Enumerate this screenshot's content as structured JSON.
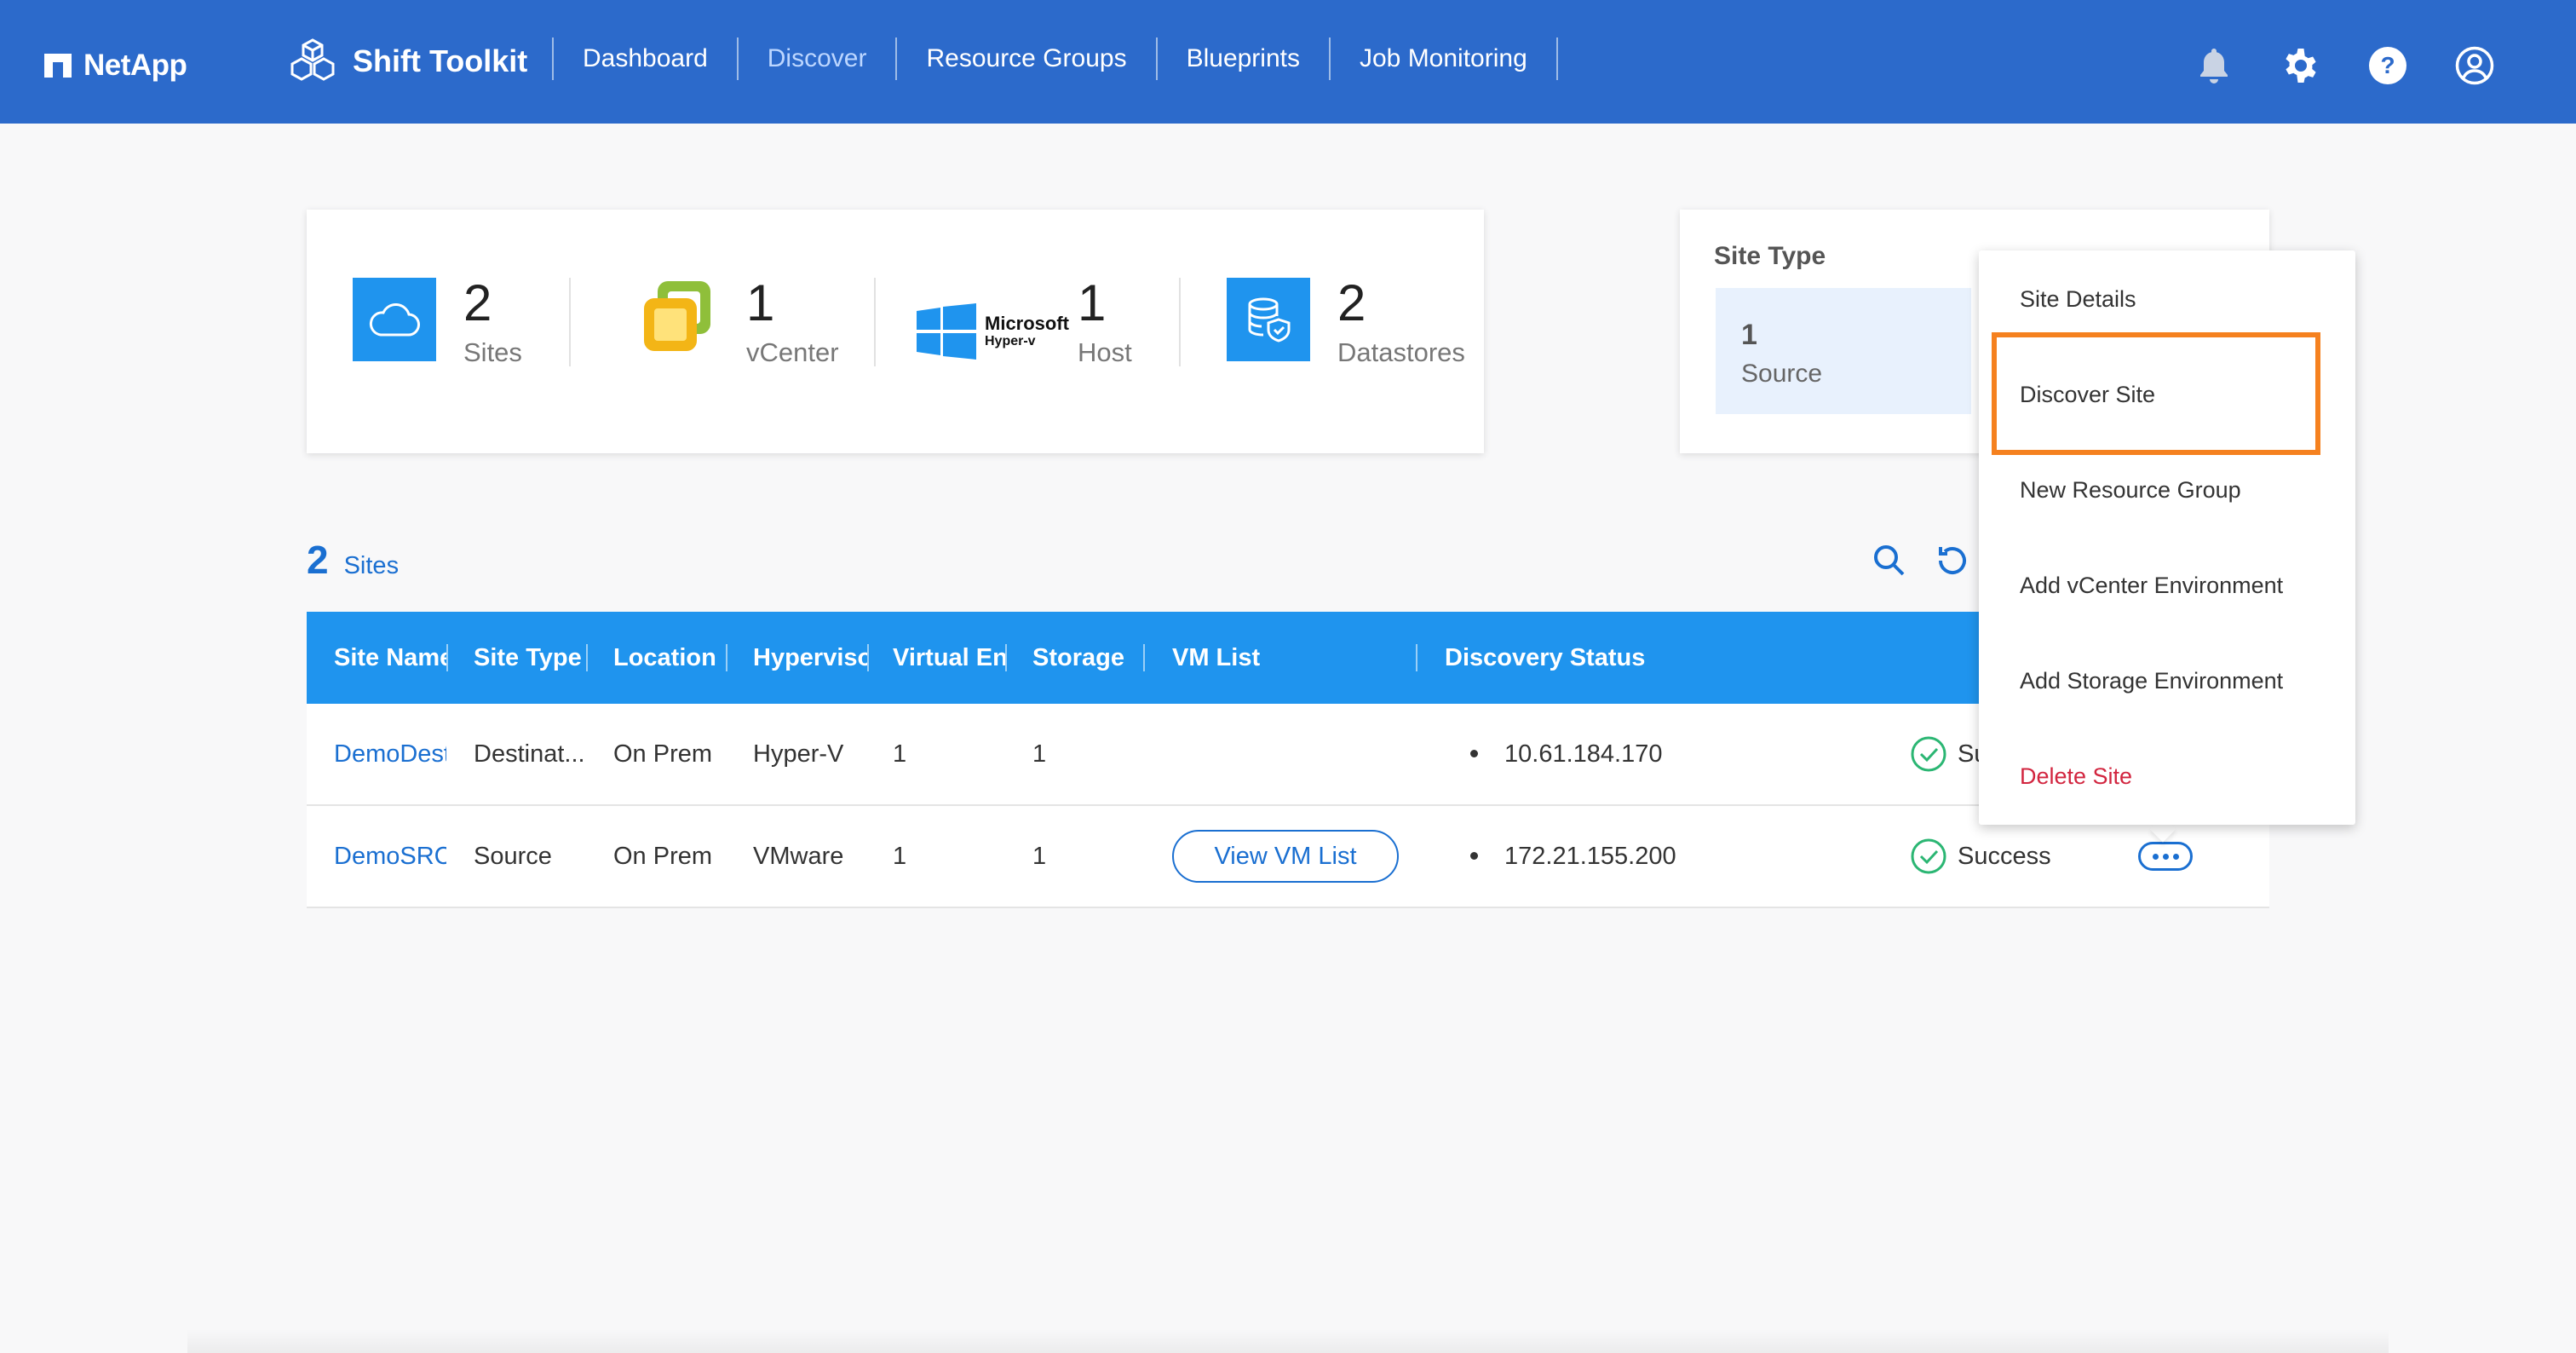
{
  "header": {
    "brand": "NetApp",
    "product": "Shift Toolkit",
    "nav": [
      {
        "label": "Dashboard",
        "active": false
      },
      {
        "label": "Discover",
        "active": true
      },
      {
        "label": "Resource Groups",
        "active": false
      },
      {
        "label": "Blueprints",
        "active": false
      },
      {
        "label": "Job Monitoring",
        "active": false
      }
    ],
    "icons": [
      "bell-icon",
      "gear-icon",
      "help-icon",
      "user-icon"
    ],
    "accent_color": "#2c6acb"
  },
  "summary": {
    "sites": {
      "value": "2",
      "label": "Sites"
    },
    "vcenter": {
      "value": "1",
      "label": "vCenter"
    },
    "host": {
      "value": "1",
      "label": "Host",
      "logo_text_1": "Microsoft",
      "logo_text_2": "Hyper-v"
    },
    "datastores": {
      "value": "2",
      "label": "Datastores"
    }
  },
  "site_type": {
    "title": "Site Type",
    "value": "1",
    "label": "Source"
  },
  "sites_heading": {
    "count": "2",
    "label": "Sites"
  },
  "table": {
    "columns": [
      "Site Name",
      "Site Type",
      "Location",
      "Hypervisor",
      "Virtual En",
      "Storage",
      "VM List",
      "Discovery Status"
    ],
    "rows": [
      {
        "site_name": "DemoDest",
        "site_type": "Destinat...",
        "location": "On Prem",
        "hypervisor": "Hyper-V",
        "virtual_env": "1",
        "storage": "1",
        "vm_list": "",
        "ip": "10.61.184.170",
        "status": "Success"
      },
      {
        "site_name": "DemoSRC",
        "site_type": "Source",
        "location": "On Prem",
        "hypervisor": "VMware",
        "virtual_env": "1",
        "storage": "1",
        "vm_list": "View VM List",
        "ip": "172.21.155.200",
        "status": "Success"
      }
    ]
  },
  "context_menu": {
    "items": [
      "Site Details",
      "Discover Site",
      "New Resource Group",
      "Add vCenter Environment",
      "Add Storage Environment",
      "Delete Site"
    ],
    "highlighted": "Discover Site",
    "highlight_color": "#f5811f",
    "danger_color": "#d2253f"
  }
}
